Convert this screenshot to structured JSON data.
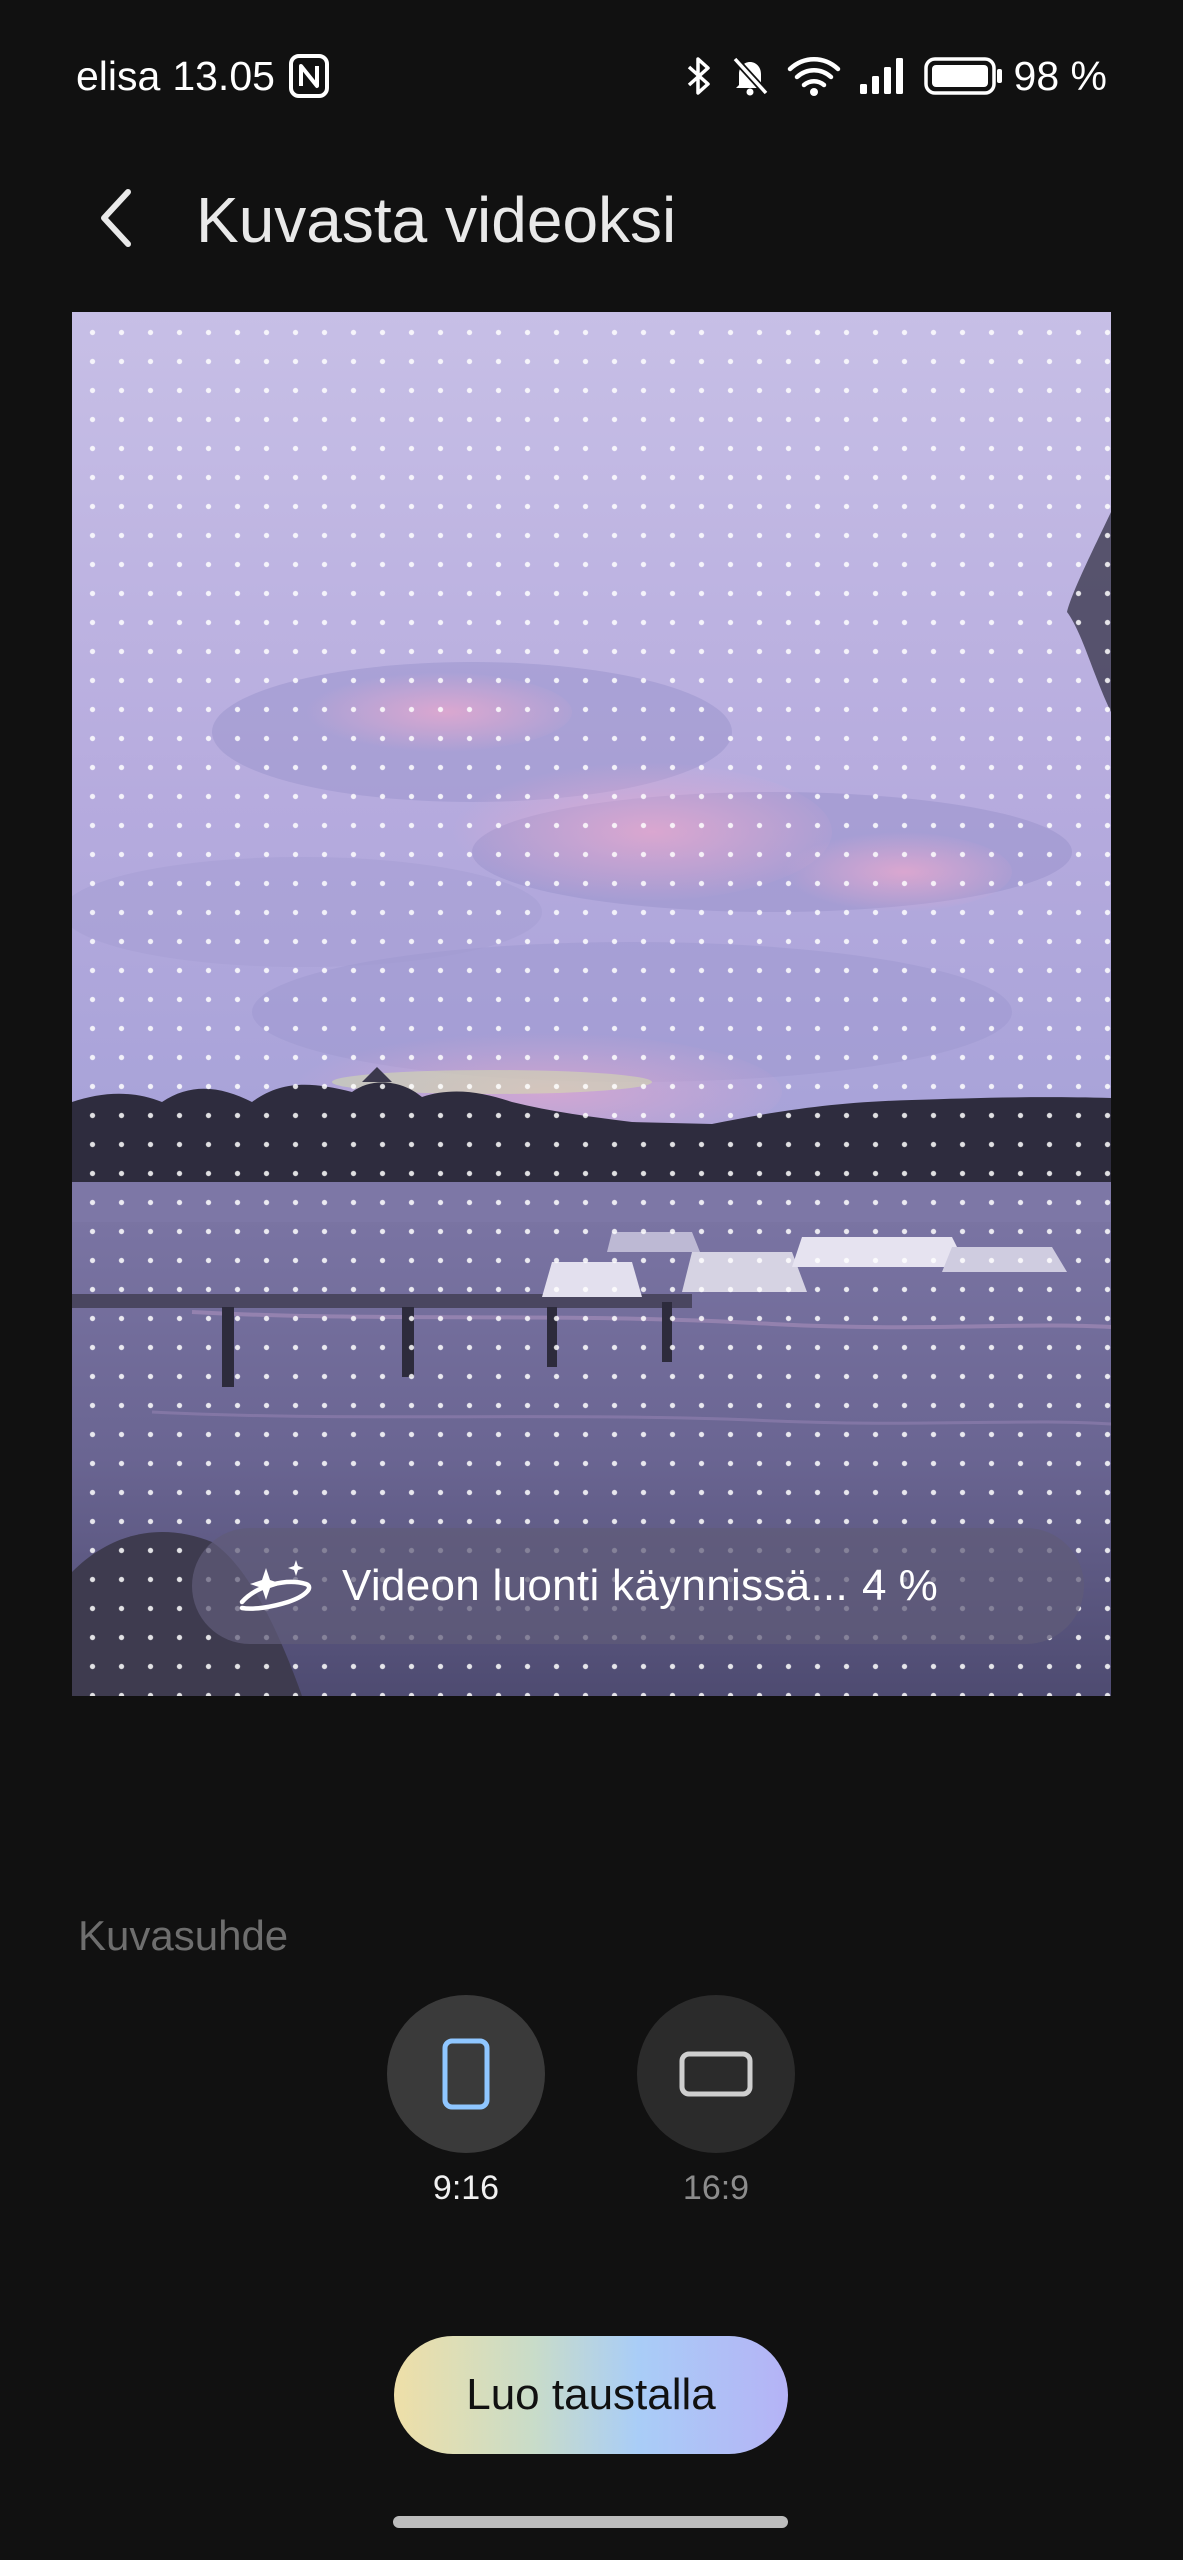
{
  "status_bar": {
    "carrier": "elisa",
    "time": "13.05",
    "battery": "98 %",
    "icons": [
      "nfc-icon",
      "bluetooth-icon",
      "mute-icon",
      "wifi-icon",
      "signal-icon",
      "battery-icon"
    ]
  },
  "header": {
    "title": "Kuvasta videoksi",
    "back_icon": "chevron-left-icon"
  },
  "preview": {
    "progress_text": "Videon luonti käynnissä...",
    "progress_value": "4 %",
    "progress_icon": "sparkle-icon"
  },
  "aspect": {
    "label": "Kuvasuhde",
    "options": [
      {
        "label": "9:16",
        "icon": "portrait-phone-icon",
        "selected": true
      },
      {
        "label": "16:9",
        "icon": "landscape-screen-icon",
        "selected": false
      }
    ]
  },
  "action": {
    "create_label": "Luo taustalla"
  },
  "colors": {
    "background": "#111111",
    "selected_accent": "#8fc6ff",
    "pill_bg": "#5f5c78"
  }
}
